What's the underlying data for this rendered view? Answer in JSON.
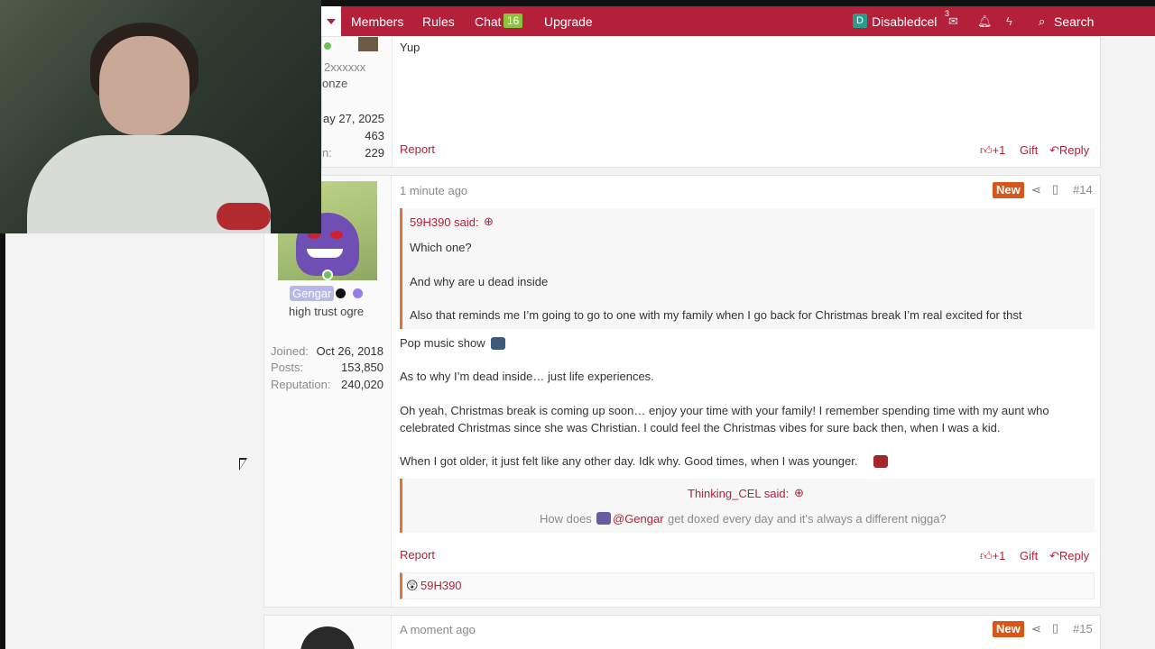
{
  "nav": {
    "links": [
      "Members",
      "Rules",
      "Chat",
      "Upgrade"
    ],
    "chat_count": "16",
    "user_initial": "D",
    "username": "Disabledcel",
    "message_count": "3",
    "search_label": "Search"
  },
  "prev_post": {
    "user_partial": "2xxxxxx",
    "rank_partial": "onze",
    "joined_partial": "ay 27, 2025",
    "posts": "463",
    "rep_label_partial": "n:",
    "reputation": "229",
    "body": "Yup",
    "report": "Report",
    "like": "+1",
    "gift": "Gift",
    "reply": "Reply"
  },
  "post14": {
    "time": "1 minute ago",
    "new": "New",
    "number": "#14",
    "author": "Gengar",
    "title": "high trust ogre",
    "joined_label": "Joined:",
    "joined": "Oct 26, 2018",
    "posts_label": "Posts:",
    "posts": "153,850",
    "rep_label": "Reputation:",
    "reputation": "240,020",
    "quote1": {
      "author": "59H390 said:",
      "lines": [
        "Which one?",
        "And why are u dead inside",
        "Also that reminds me I’m going to go to one with my family when I go back for Christmas break I’m real excited for thst"
      ]
    },
    "body": [
      "Pop music show",
      "As to why I’m dead inside… just life experiences.",
      "Oh yeah, Christmas break is coming up soon… enjoy your time with your family! I remember spending time with my aunt who",
      "celebrated Christmas since she was Christian. I could feel the Christmas vibes for sure back then, when I was a kid.",
      "When I got older, it just felt like any other day. Idk why. Good times, when I was younger."
    ],
    "quote2": {
      "author": "Thinking_CEL said:",
      "prefix": "How does",
      "mention": "@Gengar",
      "suffix": "get doxed every day and it's always a different nigga?"
    },
    "report": "Report",
    "like": "+1",
    "gift": "Gift",
    "reply": "Reply",
    "reaction_user": "59H390"
  },
  "post15": {
    "time": "A moment ago",
    "new": "New",
    "number": "#15"
  },
  "colors": {
    "brand": "#b4203a",
    "new_badge": "#d4581c",
    "quote_border": "#e0753a"
  }
}
